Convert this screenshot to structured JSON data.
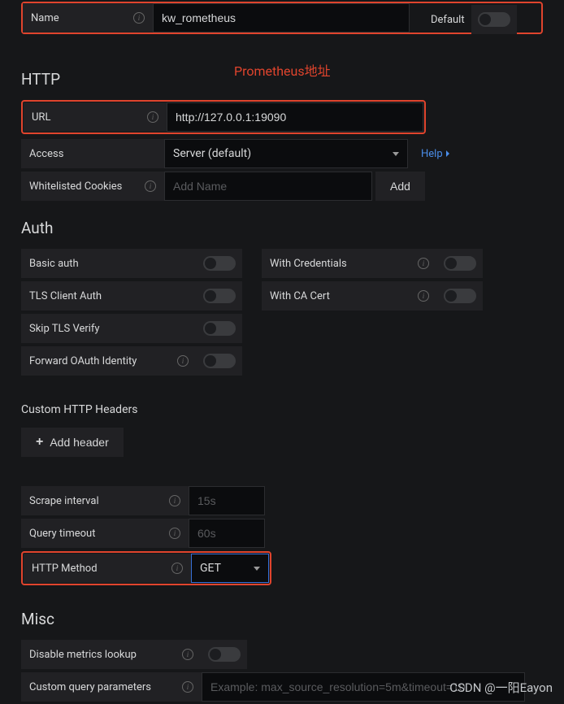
{
  "name": {
    "label": "Name",
    "value": "kw_rometheus",
    "default_label": "Default"
  },
  "annotation": "Prometheus地址",
  "http": {
    "title": "HTTP",
    "url": {
      "label": "URL",
      "value": "http://127.0.0.1:19090"
    },
    "access": {
      "label": "Access",
      "value": "Server (default)",
      "help": "Help"
    },
    "cookies": {
      "label": "Whitelisted Cookies",
      "placeholder": "Add Name",
      "add_btn": "Add"
    }
  },
  "auth": {
    "title": "Auth",
    "basic": "Basic auth",
    "credentials": "With Credentials",
    "tls_client": "TLS Client Auth",
    "ca_cert": "With CA Cert",
    "skip_tls": "Skip TLS Verify",
    "forward_oauth": "Forward OAuth Identity"
  },
  "custom_headers": {
    "title": "Custom HTTP Headers",
    "add_btn": "Add header"
  },
  "scrape": {
    "interval": {
      "label": "Scrape interval",
      "placeholder": "15s"
    },
    "timeout": {
      "label": "Query timeout",
      "placeholder": "60s"
    },
    "method": {
      "label": "HTTP Method",
      "value": "GET"
    }
  },
  "misc": {
    "title": "Misc",
    "disable_lookup": "Disable metrics lookup",
    "custom_params": {
      "label": "Custom query parameters",
      "placeholder": "Example: max_source_resolution=5m&timeout=10"
    }
  },
  "watermark": "CSDN @一阳Eayon"
}
